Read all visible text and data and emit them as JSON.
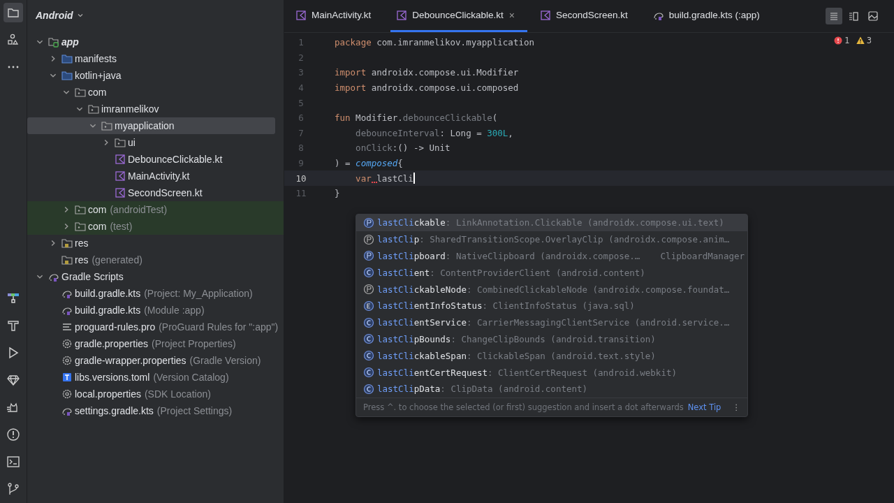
{
  "project_view": {
    "title": "Android"
  },
  "tree": [
    {
      "label": "app",
      "kind": "module",
      "expanded": true,
      "selected": false,
      "tinted": false,
      "children": [
        {
          "label": "manifests",
          "kind": "folder",
          "expanded": false,
          "selected": false,
          "tinted": false
        },
        {
          "label": "kotlin+java",
          "kind": "folder",
          "expanded": true,
          "selected": false,
          "tinted": false,
          "children": [
            {
              "label": "com",
              "kind": "package",
              "expanded": true,
              "selected": false,
              "tinted": false,
              "children": [
                {
                  "label": "imranmelikov",
                  "kind": "package",
                  "expanded": true,
                  "selected": false,
                  "tinted": false,
                  "children": [
                    {
                      "label": "myapplication",
                      "kind": "package",
                      "expanded": true,
                      "selected": true,
                      "tinted": false,
                      "children": [
                        {
                          "label": "ui",
                          "kind": "package",
                          "expanded": false,
                          "selected": false,
                          "tinted": false
                        },
                        {
                          "label": "DebounceClickable.kt",
                          "kind": "kotlin",
                          "selected": false,
                          "tinted": false
                        },
                        {
                          "label": "MainActivity.kt",
                          "kind": "kotlin",
                          "selected": false,
                          "tinted": false
                        },
                        {
                          "label": "SecondScreen.kt",
                          "kind": "kotlin",
                          "selected": false,
                          "tinted": false
                        }
                      ]
                    }
                  ]
                }
              ]
            },
            {
              "label": "com",
              "suffix": "(androidTest)",
              "kind": "package",
              "expanded": false,
              "selected": false,
              "tinted": true
            },
            {
              "label": "com",
              "suffix": "(test)",
              "kind": "package",
              "expanded": false,
              "selected": false,
              "tinted": true
            }
          ]
        },
        {
          "label": "res",
          "kind": "res",
          "expanded": false,
          "selected": false,
          "tinted": false
        },
        {
          "label": "res",
          "suffix": "(generated)",
          "kind": "res",
          "selected": false,
          "tinted": false
        }
      ]
    },
    {
      "label": "Gradle Scripts",
      "kind": "gradle",
      "expanded": true,
      "selected": false,
      "tinted": false,
      "children": [
        {
          "label": "build.gradle.kts",
          "suffix": "(Project: My_Application)",
          "kind": "gradle",
          "selected": false,
          "tinted": false
        },
        {
          "label": "build.gradle.kts",
          "suffix": "(Module :app)",
          "kind": "gradle",
          "selected": false,
          "tinted": false
        },
        {
          "label": "proguard-rules.pro",
          "suffix": "(ProGuard Rules for \":app\")",
          "kind": "text",
          "selected": false,
          "tinted": false
        },
        {
          "label": "gradle.properties",
          "suffix": "(Project Properties)",
          "kind": "settings",
          "selected": false,
          "tinted": false
        },
        {
          "label": "gradle-wrapper.properties",
          "suffix": "(Gradle Version)",
          "kind": "settings",
          "selected": false,
          "tinted": false
        },
        {
          "label": "libs.versions.toml",
          "suffix": "(Version Catalog)",
          "kind": "toml",
          "selected": false,
          "tinted": false
        },
        {
          "label": "local.properties",
          "suffix": "(SDK Location)",
          "kind": "settings",
          "selected": false,
          "tinted": false
        },
        {
          "label": "settings.gradle.kts",
          "suffix": "(Project Settings)",
          "kind": "gradle",
          "selected": false,
          "tinted": false
        }
      ]
    }
  ],
  "tabs": [
    {
      "label": "MainActivity.kt",
      "kind": "kotlin",
      "selected": false
    },
    {
      "label": "DebounceClickable.kt",
      "kind": "kotlin",
      "selected": true,
      "close": "×"
    },
    {
      "label": "SecondScreen.kt",
      "kind": "kotlin",
      "selected": false
    },
    {
      "label": "build.gradle.kts (:app)",
      "kind": "gradle",
      "selected": false
    }
  ],
  "inspections": {
    "errors": "1",
    "warnings": "3"
  },
  "code_lines": [
    {
      "number": "1",
      "tokens": [
        {
          "t": "package",
          "kind": "kw"
        },
        {
          "t": " com.imranmelikov.myapplication",
          "kind": "plain"
        }
      ]
    },
    {
      "number": "2"
    },
    {
      "number": "3",
      "tokens": [
        {
          "t": "import",
          "kind": "kw"
        },
        {
          "t": " androidx.compose.ui.Modifier",
          "kind": "plain"
        }
      ]
    },
    {
      "number": "4",
      "tokens": [
        {
          "t": "import",
          "kind": "kw"
        },
        {
          "t": " androidx.compose.ui.composed",
          "kind": "plain"
        }
      ]
    },
    {
      "number": "5"
    },
    {
      "number": "6",
      "tokens": [
        {
          "t": "fun",
          "kind": "kw"
        },
        {
          "t": " Modifier.",
          "kind": "plain"
        },
        {
          "t": "debounceClickable",
          "kind": "dim"
        },
        {
          "t": "(",
          "kind": "plain"
        }
      ]
    },
    {
      "number": "7",
      "tokens": [
        {
          "t": "    debounceInterval",
          "kind": "dim"
        },
        {
          "t": ": Long = ",
          "kind": "plain"
        },
        {
          "t": "300L",
          "kind": "num"
        },
        {
          "t": ",",
          "kind": "plain"
        }
      ]
    },
    {
      "number": "8",
      "tokens": [
        {
          "t": "    onClick",
          "kind": "dim"
        },
        {
          "t": ":() -> Unit",
          "kind": "plain"
        }
      ]
    },
    {
      "number": "9",
      "tokens": [
        {
          "t": ") = ",
          "kind": "plain"
        },
        {
          "t": "composed",
          "kind": "call"
        },
        {
          "t": "{",
          "kind": "plain"
        }
      ]
    },
    {
      "number": "10",
      "current": true,
      "tokens": [
        {
          "t": "    var",
          "kind": "kw",
          "squiggle_after": true
        },
        {
          "t": " lastCli",
          "kind": "plain"
        }
      ]
    },
    {
      "number": "11",
      "tokens": [
        {
          "t": "}",
          "kind": "plain"
        }
      ]
    }
  ],
  "completion": {
    "items": [
      {
        "kind": "property",
        "match": "lastCli",
        "rest": "ckable",
        "type": ": LinkAnnotation.Clickable (androidx.compose.ui.text)",
        "selected": true
      },
      {
        "kind": "field",
        "match": "lastCli",
        "rest": "p",
        "type": ": SharedTransitionScope.OverlayClip (androidx.compose.anim…",
        "selected": false
      },
      {
        "kind": "property",
        "match": "lastCli",
        "rest": "pboard",
        "type": ": NativeClipboard (androidx.compose.…",
        "extra": "ClipboardManager",
        "selected": false
      },
      {
        "kind": "class",
        "match": "lastCli",
        "rest": "ent",
        "type": ": ContentProviderClient (android.content)",
        "selected": false
      },
      {
        "kind": "field",
        "match": "lastCli",
        "rest": "ckableNode",
        "type": ": CombinedClickableNode (androidx.compose.foundat…",
        "selected": false
      },
      {
        "kind": "enum",
        "match": "lastCli",
        "rest": "entInfoStatus",
        "type": ": ClientInfoStatus (java.sql)",
        "selected": false
      },
      {
        "kind": "class",
        "match": "lastCli",
        "rest": "entService",
        "type": ": CarrierMessagingClientService (android.service.…",
        "selected": false
      },
      {
        "kind": "class",
        "match": "lastCli",
        "rest": "pBounds",
        "type": ": ChangeClipBounds (android.transition)",
        "selected": false
      },
      {
        "kind": "class",
        "match": "lastCli",
        "rest": "ckableSpan",
        "type": ": ClickableSpan (android.text.style)",
        "selected": false
      },
      {
        "kind": "class",
        "match": "lastCli",
        "rest": "entCertRequest",
        "type": ": ClientCertRequest (android.webkit)",
        "selected": false
      },
      {
        "kind": "class",
        "match": "lastCli",
        "rest": "pData",
        "type": ": ClipData (android.content)",
        "selected": false
      }
    ],
    "hint": "Press ^. to choose the selected (or first) suggestion and insert a dot afterwards",
    "next_tip": "Next Tip",
    "more": "⋮"
  }
}
